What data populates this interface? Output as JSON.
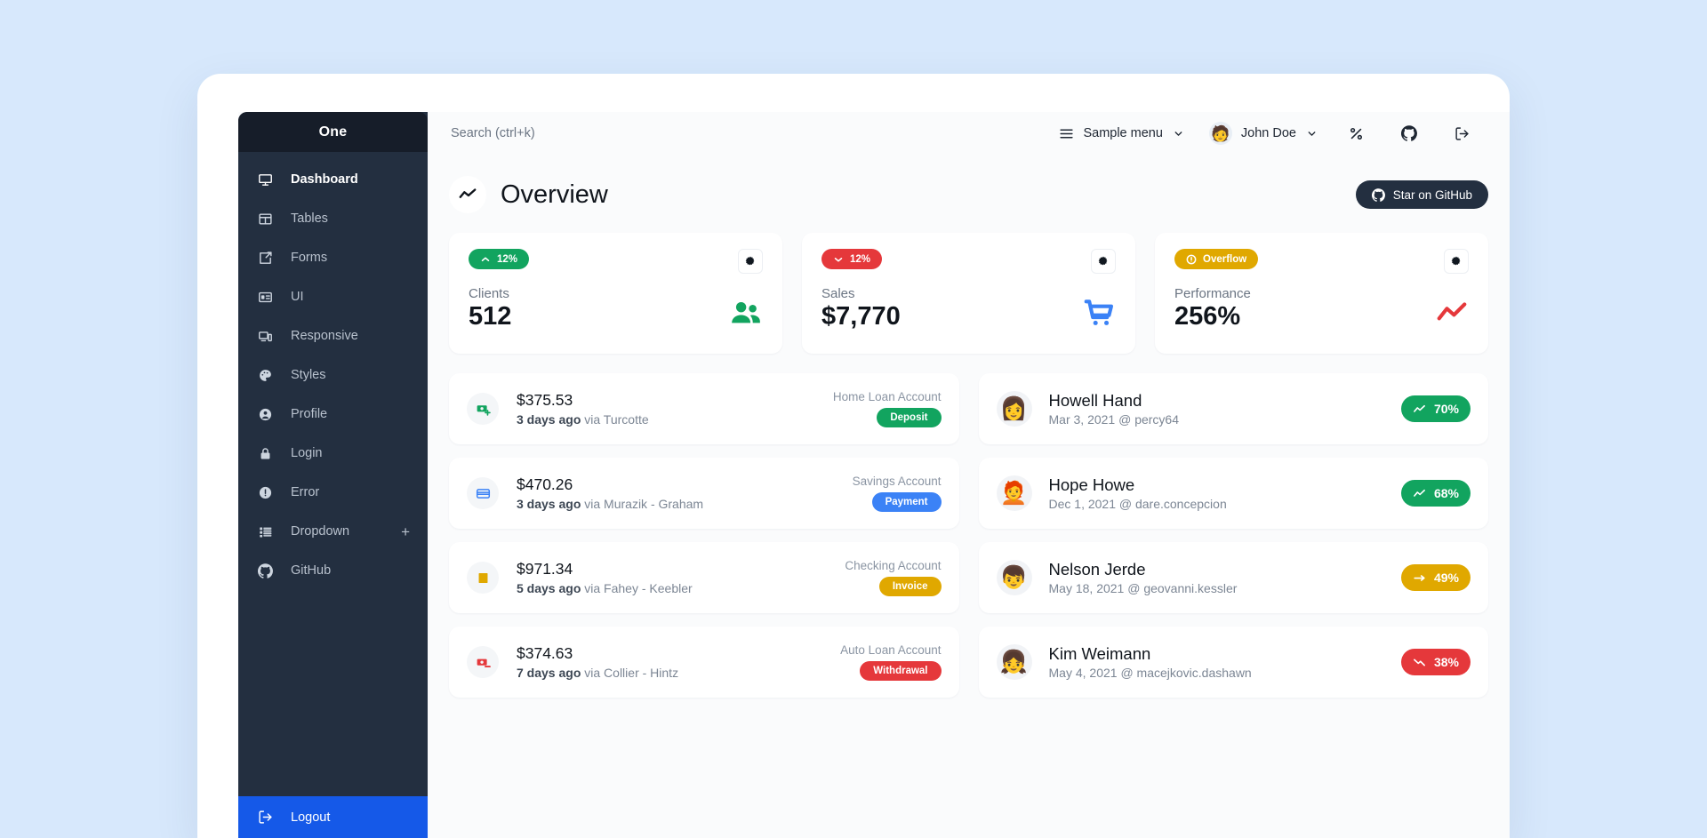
{
  "theme": {
    "page_bg": "#d7e8fc",
    "sidebar_bg": "#232f40",
    "sidebar_header_bg": "#161d29",
    "accent_blue": "#1559e8",
    "green": "#12a45f",
    "red": "#e5383b",
    "yellow": "#e0a800",
    "content_bg": "#fafbfc"
  },
  "sidebar": {
    "title": "One",
    "items": [
      {
        "label": "Dashboard",
        "icon": "monitor-icon",
        "active": true
      },
      {
        "label": "Tables",
        "icon": "table-icon",
        "active": false
      },
      {
        "label": "Forms",
        "icon": "edit-box-icon",
        "active": false
      },
      {
        "label": "UI",
        "icon": "layout-icon",
        "active": false
      },
      {
        "label": "Responsive",
        "icon": "devices-icon",
        "active": false
      },
      {
        "label": "Styles",
        "icon": "palette-icon",
        "active": false
      },
      {
        "label": "Profile",
        "icon": "account-icon",
        "active": false
      },
      {
        "label": "Login",
        "icon": "lock-icon",
        "active": false
      },
      {
        "label": "Error",
        "icon": "alert-icon",
        "active": false
      },
      {
        "label": "Dropdown",
        "icon": "list-icon",
        "active": false,
        "trailing": "+"
      },
      {
        "label": "GitHub",
        "icon": "github-icon",
        "active": false
      }
    ],
    "logout": {
      "label": "Logout",
      "icon": "logout-icon"
    }
  },
  "topbar": {
    "search_placeholder": "Search (ctrl+k)",
    "search_value": "",
    "menu": {
      "label": "Sample menu",
      "icon": "hamburger-icon",
      "caret": "chevron-down-icon"
    },
    "user": {
      "name": "John Doe",
      "avatar": "🧑",
      "caret": "chevron-down-icon"
    },
    "icons": [
      {
        "name": "theme-toggle-icon",
        "glyph": "%"
      },
      {
        "name": "github-icon"
      },
      {
        "name": "logout-icon"
      }
    ]
  },
  "hero": {
    "icon": "trend-line-icon",
    "title": "Overview",
    "github_button": {
      "label": "Star on GitHub",
      "icon": "github-icon"
    }
  },
  "stat_cards": [
    {
      "pill": {
        "text": "12%",
        "icon": "chevron-up-icon",
        "color": "#12a45f"
      },
      "label": "Clients",
      "value": "512",
      "icon": "people-icon",
      "icon_color": "#12a45f",
      "gear": "gear-icon"
    },
    {
      "pill": {
        "text": "12%",
        "icon": "chevron-down-icon",
        "color": "#e5383b"
      },
      "label": "Sales",
      "value": "$7,770",
      "icon": "cart-icon",
      "icon_color": "#3b82f6",
      "gear": "gear-icon"
    },
    {
      "pill": {
        "text": "Overflow",
        "icon": "alert-circle-icon",
        "color": "#e0a800"
      },
      "label": "Performance",
      "value": "256%",
      "icon": "trend-line-icon",
      "icon_color": "#e5383b",
      "gear": "gear-icon"
    }
  ],
  "transactions": [
    {
      "icon": "cash-plus-icon",
      "icon_color": "#12a45f",
      "amount": "$375.53",
      "time": "3 days ago",
      "via": "via Turcotte",
      "account": "Home Loan Account",
      "tag": "Deposit",
      "tag_color": "#12a45f"
    },
    {
      "icon": "credit-card-icon",
      "icon_color": "#3b82f6",
      "amount": "$470.26",
      "time": "3 days ago",
      "via": "via Murazik - Graham",
      "account": "Savings Account",
      "tag": "Payment",
      "tag_color": "#3b82f6"
    },
    {
      "icon": "receipt-icon",
      "icon_color": "#e0a800",
      "amount": "$971.34",
      "time": "5 days ago",
      "via": "via Fahey - Keebler",
      "account": "Checking Account",
      "tag": "Invoice",
      "tag_color": "#e0a800"
    },
    {
      "icon": "cash-minus-icon",
      "icon_color": "#e5383b",
      "amount": "$374.63",
      "time": "7 days ago",
      "via": "via Collier - Hintz",
      "account": "Auto Loan Account",
      "tag": "Withdrawal",
      "tag_color": "#e5383b"
    }
  ],
  "clients": [
    {
      "avatar": "👩",
      "name": "Howell Hand",
      "meta": "Mar 3, 2021 @ percy64",
      "progress": "70%",
      "trend": "trend-up-icon",
      "color": "#12a45f"
    },
    {
      "avatar": "🧑‍🦰",
      "name": "Hope Howe",
      "meta": "Dec 1, 2021 @ dare.concepcion",
      "progress": "68%",
      "trend": "trend-up-icon",
      "color": "#12a45f"
    },
    {
      "avatar": "👦",
      "name": "Nelson Jerde",
      "meta": "May 18, 2021 @ geovanni.kessler",
      "progress": "49%",
      "trend": "trend-flat-icon",
      "color": "#e0a800"
    },
    {
      "avatar": "👧",
      "name": "Kim Weimann",
      "meta": "May 4, 2021 @ macejkovic.dashawn",
      "progress": "38%",
      "trend": "trend-down-icon",
      "color": "#e5383b"
    }
  ]
}
